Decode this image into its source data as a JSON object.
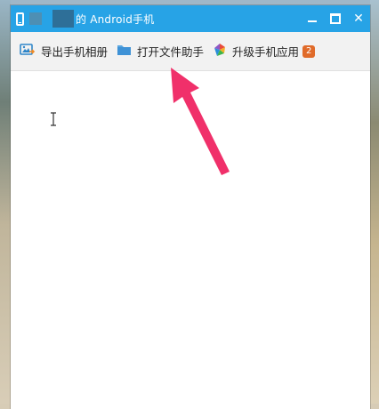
{
  "window": {
    "title": "的 Android手机",
    "controls": [
      "minimize",
      "maximize",
      "close"
    ]
  },
  "toolbar": {
    "buttons": [
      {
        "label": "导出手机相册",
        "icon": "export-photo-icon"
      },
      {
        "label": "打开文件助手",
        "icon": "folder-icon"
      },
      {
        "label": "升级手机应用",
        "icon": "app-upgrade-icon",
        "badge": "2"
      }
    ]
  },
  "annotation": {
    "color": "#f0306a"
  },
  "colors": {
    "titlebar": "#27a3e6",
    "toolbar": "#f2f2f2",
    "badge": "#e06b2a"
  }
}
